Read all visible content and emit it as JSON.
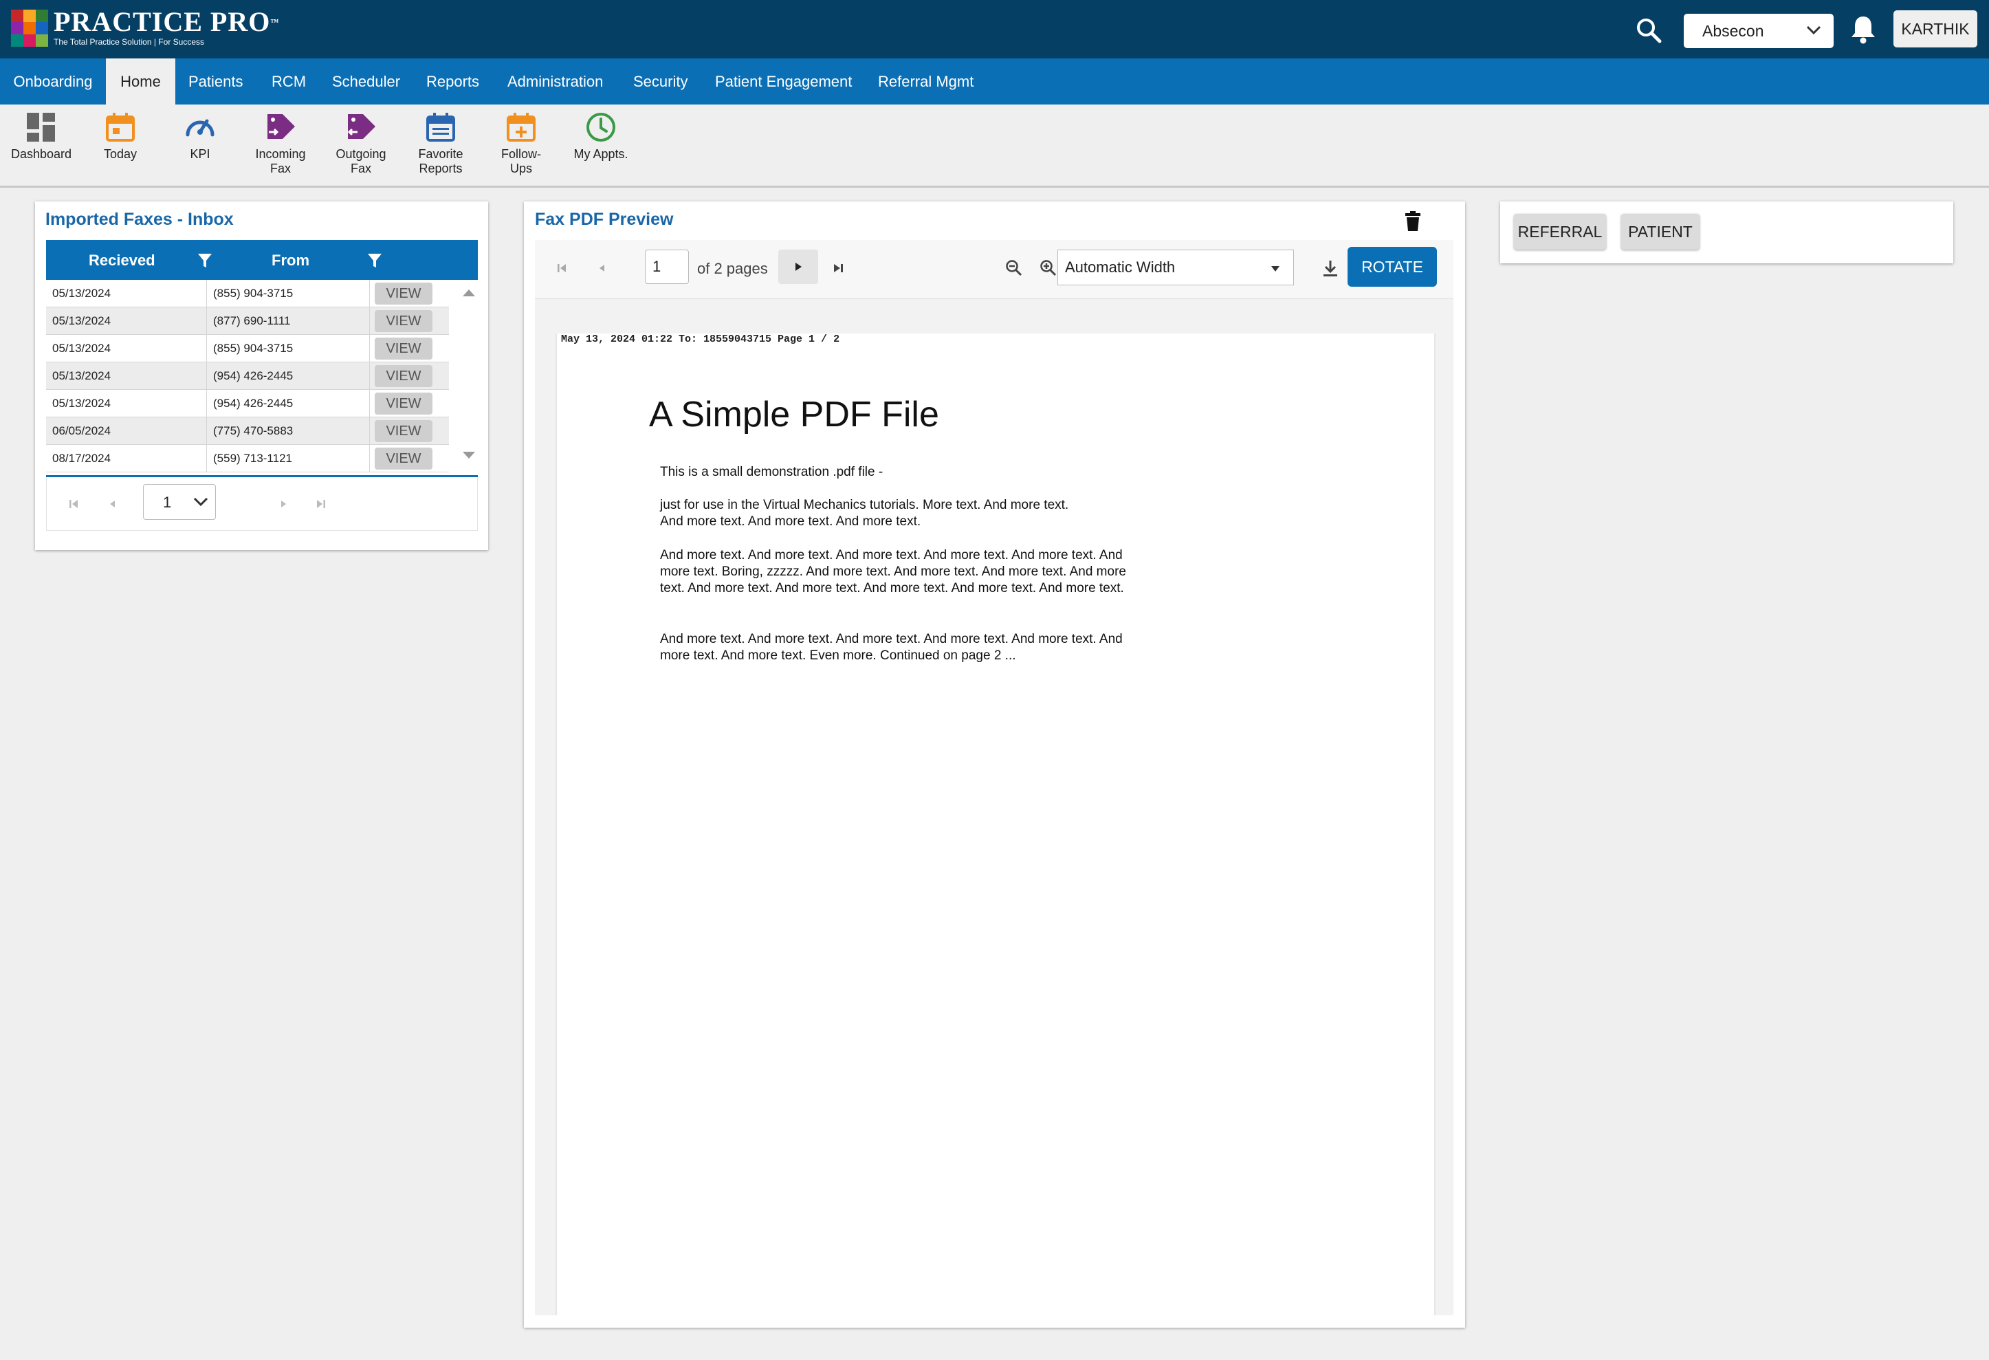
{
  "header": {
    "logo_name": "PRACTICE PRO",
    "logo_tm": "™",
    "logo_tagline": "The Total Practice Solution | For Success",
    "location": "Absecon",
    "user": "KARTHIK",
    "colors": {
      "header_bg": "#063f64",
      "nav_bg": "#0b6fb5",
      "accent": "#0b6fb5"
    }
  },
  "nav": {
    "items": [
      "Onboarding",
      "Home",
      "Patients",
      "RCM",
      "Scheduler",
      "Reports",
      "Administration",
      "Security",
      "Patient Engagement",
      "Referral Mgmt"
    ],
    "active": "Home"
  },
  "ribbon": {
    "items": [
      {
        "label": "Dashboard",
        "icon": "dashboard-icon"
      },
      {
        "label": "Today",
        "icon": "calendar-today-icon"
      },
      {
        "label": "KPI",
        "icon": "speedometer-icon"
      },
      {
        "label": "Incoming Fax",
        "icon": "incoming-fax-icon"
      },
      {
        "label": "Outgoing Fax",
        "icon": "outgoing-fax-icon"
      },
      {
        "label": "Favorite Reports",
        "icon": "report-calendar-icon"
      },
      {
        "label": "Follow-Ups",
        "icon": "calendar-plus-icon"
      },
      {
        "label": "My Appts.",
        "icon": "clock-icon"
      }
    ]
  },
  "inbox": {
    "title": "Imported Faxes - Inbox",
    "columns": [
      "Recieved",
      "From"
    ],
    "view_label": "VIEW",
    "rows": [
      {
        "received": "05/13/2024",
        "from": "(855) 904-3715"
      },
      {
        "received": "05/13/2024",
        "from": "(877) 690-1111"
      },
      {
        "received": "05/13/2024",
        "from": "(855) 904-3715"
      },
      {
        "received": "05/13/2024",
        "from": "(954) 426-2445"
      },
      {
        "received": "05/13/2024",
        "from": "(954) 426-2445"
      },
      {
        "received": "06/05/2024",
        "from": "(775) 470-5883"
      },
      {
        "received": "08/17/2024",
        "from": "(559) 713-1121"
      }
    ],
    "page": "1"
  },
  "preview": {
    "title": "Fax PDF Preview",
    "current_page": "1",
    "of_pages": "of 2 pages",
    "zoom": "Automatic Width",
    "rotate_label": "ROTATE",
    "fax_header": "May 13, 2024 01:22 To: 18559043715 Page 1 / 2",
    "doc_title": "A Simple PDF File",
    "paragraphs": [
      "This is a small demonstration .pdf file -",
      "just for use in the Virtual Mechanics tutorials. More text. And more text. And more text. And more text. And more text.",
      "And more text. And more text. And more text. And more text. And more text. And more text. Boring, zzzzz. And more text. And more text. And more text. And more text. And more text. And more text. And more text. And more text. And more text.",
      "And more text. And more text. And more text. And more text. And more text. And more text. And more text. Even more. Continued on page 2 ..."
    ]
  },
  "right_panel": {
    "buttons": [
      "REFERRAL",
      "PATIENT"
    ]
  }
}
